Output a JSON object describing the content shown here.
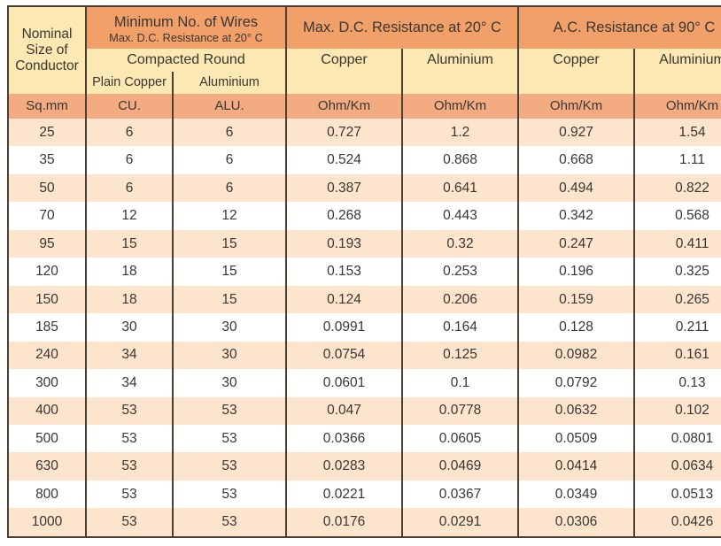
{
  "table": {
    "header": {
      "first_column": "Nominal\nSize of\nConductor",
      "first_column_lines": [
        "Nominal",
        "Size of",
        "Conductor"
      ],
      "group_bands": [
        {
          "title": "Minimum No. of Wires",
          "subtitle": "Max. D.C. Resistance at 20° C"
        },
        {
          "title": "Max. D.C. Resistance at 20° C",
          "subtitle": ""
        },
        {
          "title": "A.C. Resistance at 90° C",
          "subtitle": ""
        }
      ],
      "wires_group_label": "Compacted Round",
      "wires_sub_labels": [
        "Plain Copper",
        "Aluminium"
      ],
      "dc_sub_labels": [
        "Copper",
        "Aluminium"
      ],
      "ac_sub_labels": [
        "Copper",
        "Aluminium"
      ],
      "units": [
        "Sq.mm",
        "CU.",
        "ALU.",
        "Ohm/Km",
        "Ohm/Km",
        "Ohm/Km",
        "Ohm/Km"
      ]
    },
    "rows": [
      {
        "size": "25",
        "cu": "6",
        "alu": "6",
        "dc_cu": "0.727",
        "dc_al": "1.2",
        "ac_cu": "0.927",
        "ac_al": "1.54"
      },
      {
        "size": "35",
        "cu": "6",
        "alu": "6",
        "dc_cu": "0.524",
        "dc_al": "0.868",
        "ac_cu": "0.668",
        "ac_al": "1.11"
      },
      {
        "size": "50",
        "cu": "6",
        "alu": "6",
        "dc_cu": "0.387",
        "dc_al": "0.641",
        "ac_cu": "0.494",
        "ac_al": "0.822"
      },
      {
        "size": "70",
        "cu": "12",
        "alu": "12",
        "dc_cu": "0.268",
        "dc_al": "0.443",
        "ac_cu": "0.342",
        "ac_al": "0.568"
      },
      {
        "size": "95",
        "cu": "15",
        "alu": "15",
        "dc_cu": "0.193",
        "dc_al": "0.32",
        "ac_cu": "0.247",
        "ac_al": "0.411"
      },
      {
        "size": "120",
        "cu": "18",
        "alu": "15",
        "dc_cu": "0.153",
        "dc_al": "0.253",
        "ac_cu": "0.196",
        "ac_al": "0.325"
      },
      {
        "size": "150",
        "cu": "18",
        "alu": "15",
        "dc_cu": "0.124",
        "dc_al": "0.206",
        "ac_cu": "0.159",
        "ac_al": "0.265"
      },
      {
        "size": "185",
        "cu": "30",
        "alu": "30",
        "dc_cu": "0.0991",
        "dc_al": "0.164",
        "ac_cu": "0.128",
        "ac_al": "0.211"
      },
      {
        "size": "240",
        "cu": "34",
        "alu": "30",
        "dc_cu": "0.0754",
        "dc_al": "0.125",
        "ac_cu": "0.0982",
        "ac_al": "0.161"
      },
      {
        "size": "300",
        "cu": "34",
        "alu": "30",
        "dc_cu": "0.0601",
        "dc_al": "0.1",
        "ac_cu": "0.0792",
        "ac_al": "0.13"
      },
      {
        "size": "400",
        "cu": "53",
        "alu": "53",
        "dc_cu": "0.047",
        "dc_al": "0.0778",
        "ac_cu": "0.0632",
        "ac_al": "0.102"
      },
      {
        "size": "500",
        "cu": "53",
        "alu": "53",
        "dc_cu": "0.0366",
        "dc_al": "0.0605",
        "ac_cu": "0.0509",
        "ac_al": "0.0801"
      },
      {
        "size": "630",
        "cu": "53",
        "alu": "53",
        "dc_cu": "0.0283",
        "dc_al": "0.0469",
        "ac_cu": "0.0414",
        "ac_al": "0.0634"
      },
      {
        "size": "800",
        "cu": "53",
        "alu": "53",
        "dc_cu": "0.0221",
        "dc_al": "0.0367",
        "ac_cu": "0.0349",
        "ac_al": "0.0513"
      },
      {
        "size": "1000",
        "cu": "53",
        "alu": "53",
        "dc_cu": "0.0176",
        "dc_al": "0.0291",
        "ac_cu": "0.0306",
        "ac_al": "0.0426"
      }
    ]
  },
  "colors": {
    "header_orange": "#f2a06a",
    "header_yellow": "#fce8b2",
    "unit_orange": "#f3ac81",
    "row_odd": "#fce4cd",
    "row_even": "#ffffff",
    "border": "#4a3f33",
    "text": "#3a3632"
  }
}
